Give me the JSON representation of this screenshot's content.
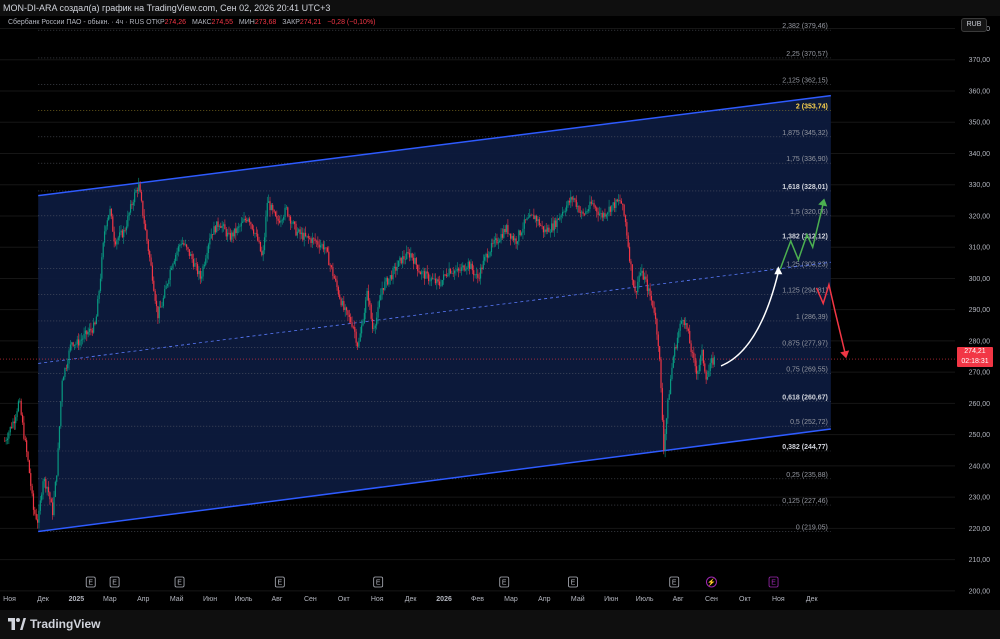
{
  "header": {
    "byline": "MON-DI-ARA создал(а) график на TradingView.com, Сен 02, 2026 20:41 UTC+3"
  },
  "legend": {
    "symbol": "Сбербанк России ПАО - обыкн. · 4ч · RUS",
    "open_label": "ОТКР",
    "open_value": "274,26",
    "high_label": "МАКС",
    "high_value": "274,55",
    "low_label": "МИН",
    "low_value": "273,68",
    "close_label": "ЗАКР",
    "close_value": "274,21",
    "change": "−0,28 (−0,10%)"
  },
  "currency": "RUB",
  "price_tag": {
    "price": "274,21",
    "timer": "02:18:31"
  },
  "brand": "TradingView",
  "colors": {
    "background": "#000000",
    "channel_fill": "#0d1a3d",
    "channel_line": "#2e5bff",
    "candle_up": "#089981",
    "candle_down": "#f23645",
    "arrow_up": "#4caf50",
    "arrow_down": "#f23645",
    "arrow_curve": "#ffffff"
  },
  "chart_data": {
    "type": "candlestick",
    "y_axis": {
      "range": [
        199,
        384
      ],
      "ticks": [
        "380,00",
        "370,00",
        "360,00",
        "350,00",
        "340,00",
        "330,00",
        "320,00",
        "310,00",
        "300,00",
        "290,00",
        "280,00",
        "270,00",
        "260,00",
        "250,00",
        "240,00",
        "230,00",
        "220,00",
        "210,00",
        "200,00"
      ],
      "tick_values": [
        380,
        370,
        360,
        350,
        340,
        330,
        320,
        310,
        300,
        290,
        280,
        270,
        260,
        250,
        240,
        230,
        220,
        210,
        200
      ]
    },
    "x_axis": {
      "labels": [
        "Ноя",
        "Дек",
        "2025",
        "Мар",
        "Апр",
        "Май",
        "Июн",
        "Июль",
        "Авг",
        "Сен",
        "Окт",
        "Ноя",
        "Дек",
        "2026",
        "Фев",
        "Мар",
        "Апр",
        "Май",
        "Июн",
        "Июль",
        "Авг",
        "Сен",
        "Окт",
        "Ноя",
        "Дек"
      ],
      "bold": [
        "2025",
        "2026"
      ]
    },
    "fib_levels": [
      {
        "ratio": 0,
        "label": "0 (219,05)",
        "value": 219.05
      },
      {
        "ratio": 0.125,
        "label": "0,125 (227,46)",
        "value": 227.46
      },
      {
        "ratio": 0.25,
        "label": "0,25 (235,88)",
        "value": 235.88
      },
      {
        "ratio": 0.382,
        "label": "0,382 (244,77)",
        "value": 244.77,
        "strong": true
      },
      {
        "ratio": 0.5,
        "label": "0,5 (252,72)",
        "value": 252.72
      },
      {
        "ratio": 0.618,
        "label": "0,618 (260,67)",
        "value": 260.67,
        "strong": true
      },
      {
        "ratio": 0.75,
        "label": "0,75 (269,55)",
        "value": 269.55
      },
      {
        "ratio": 0.875,
        "label": "0,875 (277,97)",
        "value": 277.97
      },
      {
        "ratio": 1,
        "label": "1 (286,39)",
        "value": 286.39
      },
      {
        "ratio": 1.125,
        "label": "1,125 (294,81)",
        "value": 294.81
      },
      {
        "ratio": 1.25,
        "label": "1,25 (303,23)",
        "value": 303.23
      },
      {
        "ratio": 1.382,
        "label": "1,382 (312,12)",
        "value": 312.12,
        "strong": true
      },
      {
        "ratio": 1.5,
        "label": "1,5 (320,06)",
        "value": 320.06
      },
      {
        "ratio": 1.618,
        "label": "1,618 (328,01)",
        "value": 328.01,
        "strong": true
      },
      {
        "ratio": 1.75,
        "label": "1,75 (336,90)",
        "value": 336.9
      },
      {
        "ratio": 1.875,
        "label": "1,875 (345,32)",
        "value": 345.32
      },
      {
        "ratio": 2,
        "label": "2 (353,74)",
        "value": 353.74,
        "gold": true
      },
      {
        "ratio": 2.125,
        "label": "2,125 (362,15)",
        "value": 362.15
      },
      {
        "ratio": 2.25,
        "label": "2,25 (370,57)",
        "value": 370.57
      },
      {
        "ratio": 2.382,
        "label": "2,382 (379,46)",
        "value": 379.46
      }
    ],
    "channel": {
      "upper": [
        [
          0.04,
          326.5
        ],
        [
          0.87,
          358.5
        ]
      ],
      "lower": [
        [
          0.04,
          219.0
        ],
        [
          0.87,
          251.8
        ]
      ],
      "mid": [
        [
          0.04,
          272.8
        ],
        [
          0.87,
          305.2
        ]
      ]
    },
    "price_path": [
      [
        0.005,
        248
      ],
      [
        0.015,
        255
      ],
      [
        0.02,
        261
      ],
      [
        0.025,
        250
      ],
      [
        0.03,
        240
      ],
      [
        0.035,
        226
      ],
      [
        0.04,
        222
      ],
      [
        0.045,
        236
      ],
      [
        0.05,
        233
      ],
      [
        0.055,
        225
      ],
      [
        0.06,
        240
      ],
      [
        0.065,
        268
      ],
      [
        0.07,
        273
      ],
      [
        0.075,
        280
      ],
      [
        0.08,
        279
      ],
      [
        0.09,
        282
      ],
      [
        0.1,
        285
      ],
      [
        0.105,
        300
      ],
      [
        0.11,
        317
      ],
      [
        0.115,
        322
      ],
      [
        0.12,
        312
      ],
      [
        0.13,
        315
      ],
      [
        0.14,
        326
      ],
      [
        0.145,
        330
      ],
      [
        0.15,
        320
      ],
      [
        0.155,
        310
      ],
      [
        0.16,
        300
      ],
      [
        0.165,
        288
      ],
      [
        0.17,
        292
      ],
      [
        0.18,
        305
      ],
      [
        0.19,
        312
      ],
      [
        0.2,
        307
      ],
      [
        0.21,
        300
      ],
      [
        0.22,
        314
      ],
      [
        0.23,
        318
      ],
      [
        0.24,
        313
      ],
      [
        0.25,
        316
      ],
      [
        0.26,
        320
      ],
      [
        0.27,
        312
      ],
      [
        0.275,
        306
      ],
      [
        0.28,
        325
      ],
      [
        0.29,
        318
      ],
      [
        0.3,
        322
      ],
      [
        0.31,
        315
      ],
      [
        0.32,
        313
      ],
      [
        0.33,
        312
      ],
      [
        0.34,
        310
      ],
      [
        0.35,
        300
      ],
      [
        0.36,
        290
      ],
      [
        0.37,
        285
      ],
      [
        0.375,
        278
      ],
      [
        0.38,
        287
      ],
      [
        0.385,
        296
      ],
      [
        0.39,
        284
      ],
      [
        0.395,
        288
      ],
      [
        0.4,
        297
      ],
      [
        0.41,
        301
      ],
      [
        0.42,
        306
      ],
      [
        0.43,
        308
      ],
      [
        0.44,
        302
      ],
      [
        0.45,
        300
      ],
      [
        0.46,
        298
      ],
      [
        0.47,
        303
      ],
      [
        0.48,
        302
      ],
      [
        0.49,
        305
      ],
      [
        0.5,
        300
      ],
      [
        0.51,
        308
      ],
      [
        0.52,
        312
      ],
      [
        0.53,
        316
      ],
      [
        0.54,
        312
      ],
      [
        0.55,
        318
      ],
      [
        0.56,
        320
      ],
      [
        0.57,
        315
      ],
      [
        0.58,
        317
      ],
      [
        0.59,
        322
      ],
      [
        0.6,
        326
      ],
      [
        0.61,
        320
      ],
      [
        0.62,
        324
      ],
      [
        0.63,
        320
      ],
      [
        0.64,
        323
      ],
      [
        0.65,
        325
      ],
      [
        0.655,
        318
      ],
      [
        0.66,
        305
      ],
      [
        0.665,
        295
      ],
      [
        0.67,
        302
      ],
      [
        0.675,
        300
      ],
      [
        0.68,
        295
      ],
      [
        0.685,
        290
      ],
      [
        0.69,
        278
      ],
      [
        0.695,
        246
      ],
      [
        0.7,
        262
      ],
      [
        0.705,
        275
      ],
      [
        0.71,
        282
      ],
      [
        0.715,
        288
      ],
      [
        0.72,
        283
      ],
      [
        0.725,
        275
      ],
      [
        0.73,
        270
      ],
      [
        0.735,
        276
      ],
      [
        0.74,
        268
      ],
      [
        0.745,
        273
      ],
      [
        0.748,
        274
      ]
    ],
    "forecast": {
      "curve": [
        [
          0.755,
          272
        ],
        [
          0.795,
          277
        ],
        [
          0.815,
          302
        ]
      ],
      "up": [
        [
          0.817,
          303
        ],
        [
          0.828,
          312
        ],
        [
          0.836,
          306
        ],
        [
          0.845,
          314
        ],
        [
          0.851,
          310
        ],
        [
          0.862,
          324
        ]
      ],
      "down": [
        [
          0.855,
          297
        ],
        [
          0.862,
          292
        ],
        [
          0.868,
          298
        ],
        [
          0.874,
          290
        ],
        [
          0.885,
          276
        ]
      ]
    },
    "events": [
      {
        "x": 0.095,
        "label": "E"
      },
      {
        "x": 0.12,
        "label": "E"
      },
      {
        "x": 0.188,
        "label": "E"
      },
      {
        "x": 0.293,
        "label": "E"
      },
      {
        "x": 0.396,
        "label": "E"
      },
      {
        "x": 0.528,
        "label": "E"
      },
      {
        "x": 0.6,
        "label": "E"
      },
      {
        "x": 0.706,
        "label": "E"
      },
      {
        "x": 0.745,
        "label": "⚡",
        "color": "#9c27b0"
      },
      {
        "x": 0.81,
        "label": "E",
        "color": "#9c27b0"
      }
    ]
  }
}
